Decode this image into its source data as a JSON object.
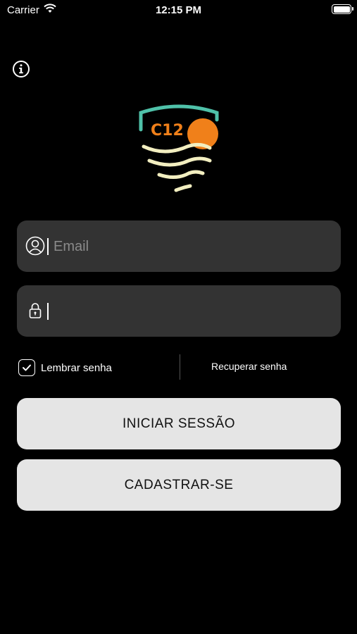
{
  "status_bar": {
    "carrier": "Carrier",
    "time": "12:15 PM"
  },
  "login": {
    "email_placeholder": "Email",
    "password_value": "",
    "remember_label": "Lembrar senha",
    "remember_checked": true,
    "recover_label": "Recuperar senha",
    "login_button": "INICIAR SESSÃO",
    "signup_button": "CADASTRAR-SE"
  },
  "logo": {
    "text": "C12",
    "teal": "#4fc1a9",
    "orange": "#f0801a",
    "cream": "#f2eec0"
  },
  "colors": {
    "background": "#000000",
    "field": "#333333",
    "button": "#e5e5e5"
  }
}
